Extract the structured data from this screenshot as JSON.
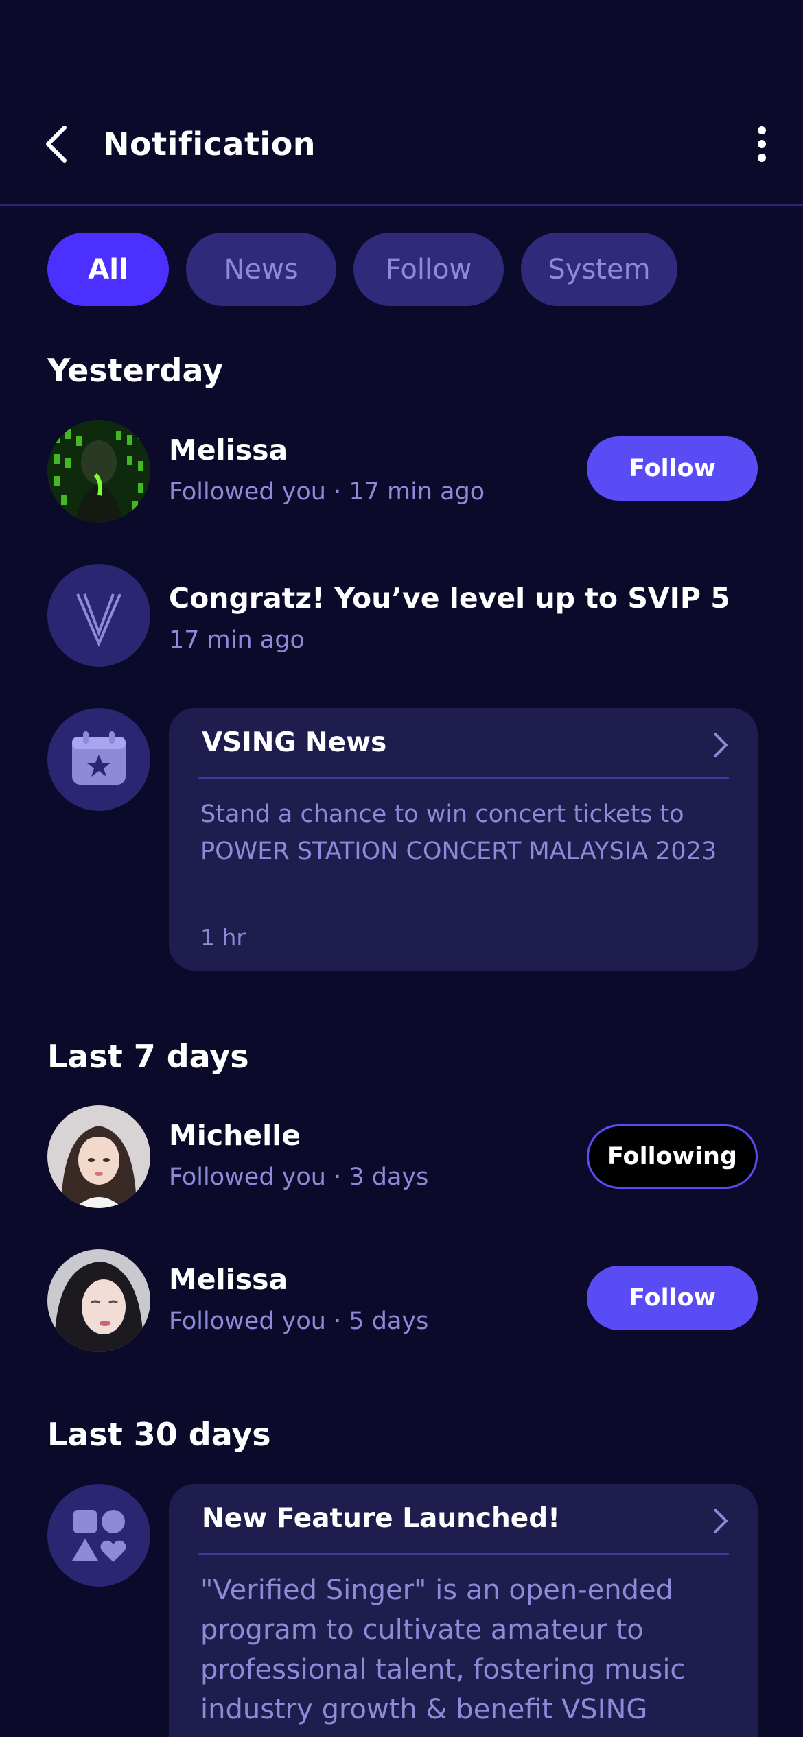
{
  "header": {
    "title": "Notification"
  },
  "tabs": [
    {
      "label": "All",
      "active": true
    },
    {
      "label": "News",
      "active": false
    },
    {
      "label": "Follow",
      "active": false
    },
    {
      "label": "System",
      "active": false
    }
  ],
  "sections": {
    "yesterday": "Yesterday",
    "last7": "Last 7 days",
    "last30": "Last 30 days"
  },
  "notifications": {
    "melissa1": {
      "name": "Melissa",
      "sub": "Followed you · 17 min ago",
      "button": "Follow"
    },
    "svip": {
      "title": "Congratz! You’ve level up to SVIP 5",
      "sub": "17 min ago"
    },
    "news": {
      "title": "VSING News",
      "body": "Stand a chance to win concert tickets to POWER STATION CONCERT MALAYSIA 2023",
      "time": "1 hr"
    },
    "michelle": {
      "name": "Michelle",
      "sub": "Followed you · 3 days",
      "button": "Following"
    },
    "melissa2": {
      "name": "Melissa",
      "sub": "Followed you · 5 days",
      "button": "Follow"
    },
    "feature": {
      "title": "New Feature Launched!",
      "body": "\"Verified Singer\" is an open-ended program to cultivate amateur to professional talent, fostering music industry growth & benefit VSING"
    }
  },
  "colors": {
    "background": "#0b0a2a",
    "accent": "#4b30ff",
    "button": "#5a4cf5",
    "muted_text": "#8e8ad8"
  }
}
